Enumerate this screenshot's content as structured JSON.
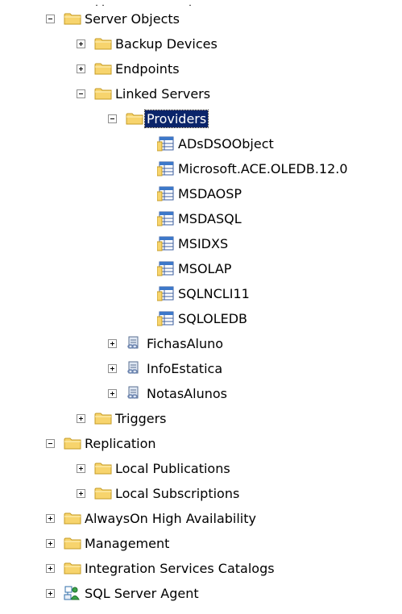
{
  "tree": {
    "server_objects": {
      "label": "Server Objects",
      "backup_devices": "Backup Devices",
      "endpoints": "Endpoints",
      "linked_servers": {
        "label": "Linked Servers",
        "providers": {
          "label": "Providers",
          "items": [
            "ADsDSOObject",
            "Microsoft.ACE.OLEDB.12.0",
            "MSDAOSP",
            "MSDASQL",
            "MSIDXS",
            "MSOLAP",
            "SQLNCLI11",
            "SQLOLEDB"
          ]
        },
        "servers": [
          "FichasAluno",
          "InfoEstatica",
          "NotasAlunos"
        ]
      },
      "triggers": "Triggers"
    },
    "replication": {
      "label": "Replication",
      "local_publications": "Local Publications",
      "local_subscriptions": "Local Subscriptions"
    },
    "always_on": "AlwaysOn High Availability",
    "management": "Management",
    "integration_services": "Integration Services Catalogs",
    "sql_server_agent": "SQL Server Agent"
  },
  "icons": {
    "folder": "folder-icon",
    "provider": "table-icon",
    "linked_server": "linked-server-icon",
    "agent": "sql-agent-icon"
  },
  "colors": {
    "selection": "#0a246a",
    "folder_fill": "#f7d46d",
    "folder_edge": "#c69b24"
  }
}
